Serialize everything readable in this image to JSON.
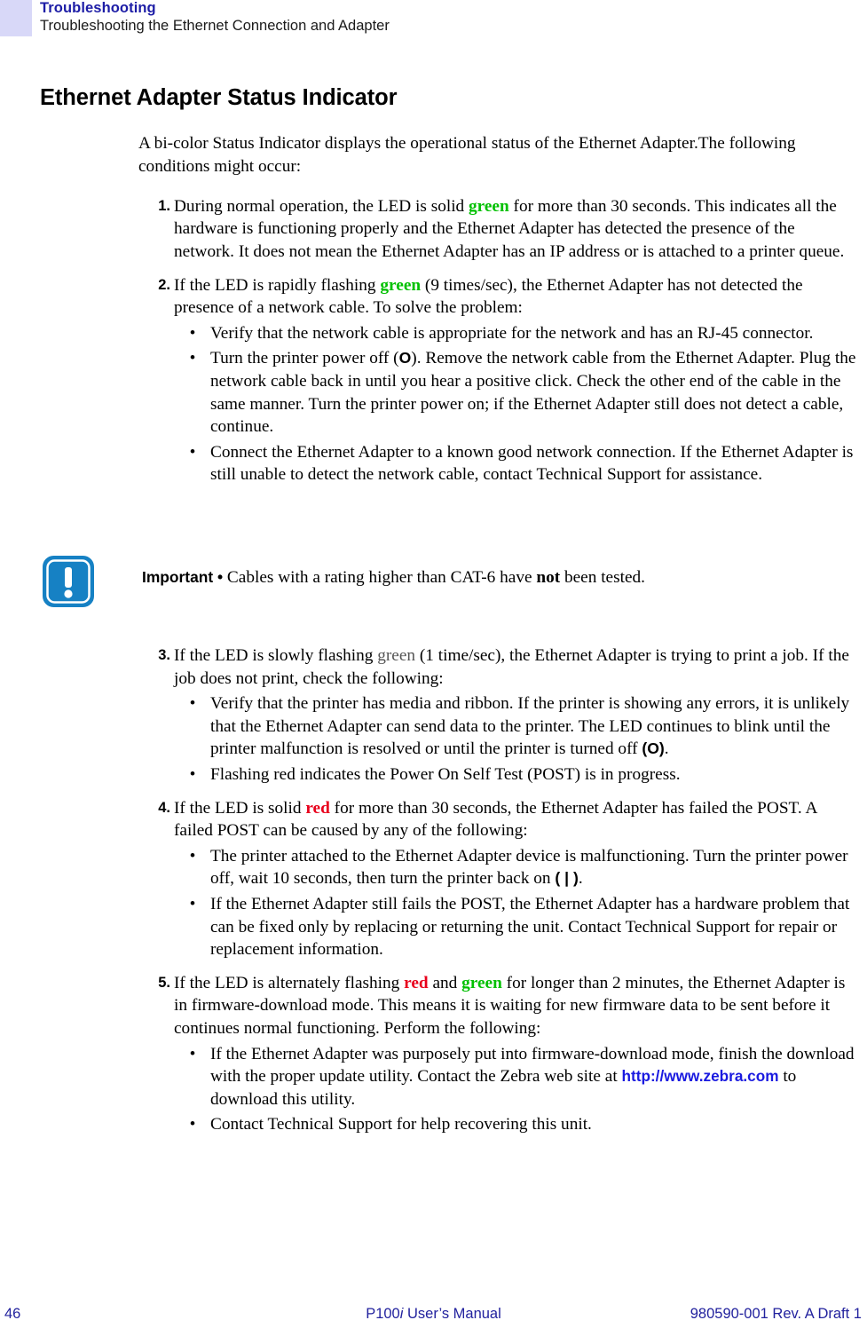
{
  "header": {
    "chapter": "Troubleshooting",
    "section": "Troubleshooting the Ethernet Connection and Adapter",
    "swatch_color": "#d8d8f8",
    "chapter_color": "#1d1da6"
  },
  "heading": "Ethernet Adapter Status Indicator",
  "intro": "A bi-color Status Indicator displays the operational status of the Ethernet Adapter.The following conditions might occur:",
  "colors": {
    "green": "#00c000",
    "red": "#e8001c",
    "link": "#1a1ae0",
    "footer": "#22229e",
    "note_blue": "#1681c4"
  },
  "steps": [
    {
      "number": "1.",
      "text_1": "During normal operation, the LED is solid ",
      "kw_1": "green",
      "kw_1_style": "green",
      "text_2": " for more than 30 seconds. This indicates all the hardware is functioning properly and the Ethernet Adapter has detected the presence of the network. It does not mean the Ethernet Adapter has an IP address or is attached to a printer queue.",
      "bullets": []
    },
    {
      "number": "2.",
      "text_1": "If the LED is rapidly flashing ",
      "kw_1": "green",
      "kw_1_style": "green",
      "text_2": " (9 times/sec), the Ethernet Adapter has not detected the presence of a network cable. To solve the problem:",
      "bullets": [
        {
          "marker": "•",
          "text_1": "Verify that the network cable is appropriate for the network and has an RJ-45 connector.",
          "sym": "",
          "text_2": ""
        },
        {
          "marker": "•",
          "text_1": "Turn the printer power off (",
          "sym": "O",
          "text_2": "). Remove the network cable from the Ethernet Adapter. Plug the network cable back in until you hear a positive click. Check the other end of the cable in the same manner. Turn the printer power on; if the Ethernet Adapter still does not detect a cable, continue."
        },
        {
          "marker": "•",
          "text_1": "Connect the Ethernet Adapter to a known good network connection. If the Ethernet Adapter is still unable to detect the network cable, contact Technical Support for assistance.",
          "sym": "",
          "text_2": ""
        }
      ]
    }
  ],
  "note": {
    "icon_name": "important-exclamation-icon",
    "label": "Important •",
    "text_1": " Cables with a rating higher than CAT-6 have ",
    "emphasis": "not",
    "text_2": " been tested."
  },
  "steps_after_note": [
    {
      "number": "3.",
      "text_1": "If the LED is slowly flashing ",
      "kw_1": "green",
      "kw_1_style": "plain",
      "text_2": " (1 time/sec), the Ethernet Adapter is trying to print a job. If the job does not print, check the following:",
      "bullets": [
        {
          "marker": "•",
          "text_1": "Verify that the printer has media and ribbon. If the printer is showing any errors, it is unlikely that the Ethernet Adapter can send data to the printer. The LED continues to blink until the printer malfunction is resolved or until the printer is turned off ",
          "sym": "(O)",
          "text_2": "."
        },
        {
          "marker": "•",
          "text_1": "Flashing red indicates the Power On Self Test (POST) is in progress.",
          "sym": "",
          "text_2": ""
        }
      ]
    },
    {
      "number": "4.",
      "text_1": "If the LED is solid ",
      "kw_1": "red",
      "kw_1_style": "red",
      "text_2": " for more than 30 seconds, the Ethernet Adapter has failed the POST. A failed POST can be caused by any of the following:",
      "bullets": [
        {
          "marker": "•",
          "text_1": "The printer attached to the Ethernet Adapter device is malfunctioning. Turn the printer power off, wait 10 seconds, then turn the printer back on ",
          "sym": "( | )",
          "text_2": "."
        },
        {
          "marker": "•",
          "text_1": "If the Ethernet Adapter still fails the POST, the Ethernet Adapter has a hardware problem that can be fixed only by replacing or returning the unit. Contact Technical Support for repair or replacement information.",
          "sym": "",
          "text_2": ""
        }
      ]
    },
    {
      "number": "5.",
      "text_1": "If the LED is alternately flashing ",
      "kw_1": "red",
      "kw_1_style": "red",
      "text_mid": " and ",
      "kw_2": "green",
      "kw_2_style": "green",
      "text_2": " for longer than 2 minutes, the Ethernet Adapter is in firmware-download mode. This means it is waiting for new firmware data to be sent before it continues normal functioning. Perform the following:",
      "bullets": [
        {
          "marker": "•",
          "text_1": "If the Ethernet Adapter was purposely put into firmware-download mode, finish the download with the proper update utility. Contact the Zebra web site at ",
          "url": "http://www.zebra.com",
          "text_2": " to download this utility."
        },
        {
          "marker": "•",
          "text_1": "Contact Technical Support for help recovering this unit.",
          "url": "",
          "text_2": ""
        }
      ]
    }
  ],
  "footer": {
    "page_number": "46",
    "manual_prefix": "P100",
    "manual_italic": "i",
    "manual_suffix": " User’s Manual",
    "doc_id": "980590-001 Rev. A Draft 1"
  }
}
